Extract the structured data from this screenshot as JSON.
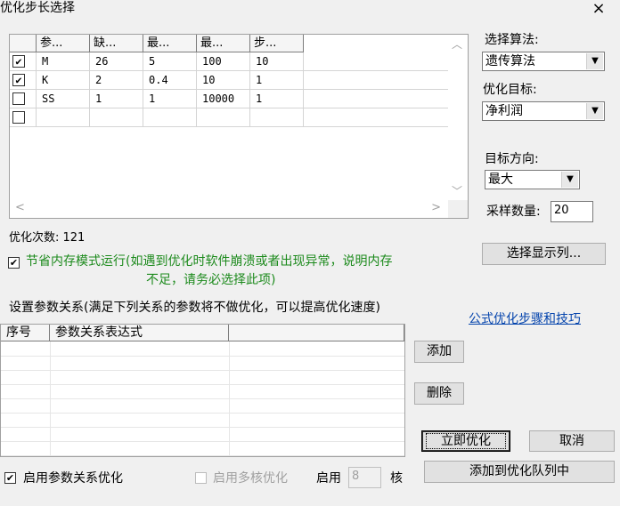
{
  "window": {
    "title": "优化步长选择"
  },
  "params_grid": {
    "headers": [
      "参...",
      "缺...",
      "最...",
      "最...",
      "步..."
    ],
    "rows": [
      {
        "checked": true,
        "check_mark": "✔",
        "name": "M",
        "default": "26",
        "min": "5",
        "max": "100",
        "step": "10"
      },
      {
        "checked": true,
        "check_mark": "✔",
        "name": "K",
        "default": "2",
        "min": "0.4",
        "max": "10",
        "step": "1"
      },
      {
        "checked": false,
        "check_mark": "",
        "name": "SS",
        "default": "1",
        "min": "1",
        "max": "10000",
        "step": "1"
      },
      {
        "checked": false,
        "check_mark": "",
        "name": "",
        "default": "",
        "min": "",
        "max": "",
        "step": ""
      }
    ]
  },
  "algorithm": {
    "label": "选择算法:",
    "value": "遗传算法"
  },
  "target": {
    "label": "优化目标:",
    "value": "净利润"
  },
  "direction": {
    "label": "目标方向:",
    "value": "最大"
  },
  "sample": {
    "label": "采样数量:",
    "value": "20"
  },
  "opt_count": "优化次数: 121",
  "memory_mode": {
    "checked": true,
    "line1": "节省内存模式运行(如遇到优化时软件崩溃或者出现异常，说明内存",
    "line2": "不足，请务必选择此项)"
  },
  "select_columns_button": "选择显示列...",
  "relation": {
    "description": "设置参数关系(满足下列关系的参数将不做优化，可以提高优化速度)",
    "link": "公式优化步骤和技巧",
    "headers": [
      "序号",
      "参数关系表达式"
    ],
    "add_button": "添加",
    "delete_button": "删除"
  },
  "enable_relation": {
    "checked": true,
    "label": "启用参数关系优化"
  },
  "enable_multicore": {
    "checked": false,
    "label": "启用多核优化"
  },
  "cores": {
    "label_before": "启用",
    "value": "8",
    "label_after": "核"
  },
  "buttons": {
    "start": "立即优化",
    "cancel": "取消",
    "add_queue": "添加到优化队列中"
  },
  "icons": {
    "close": "×",
    "dropdown": "▼",
    "scroll_up": "︿",
    "scroll_down": "﹀",
    "scroll_left": "<",
    "scroll_right": ">"
  }
}
